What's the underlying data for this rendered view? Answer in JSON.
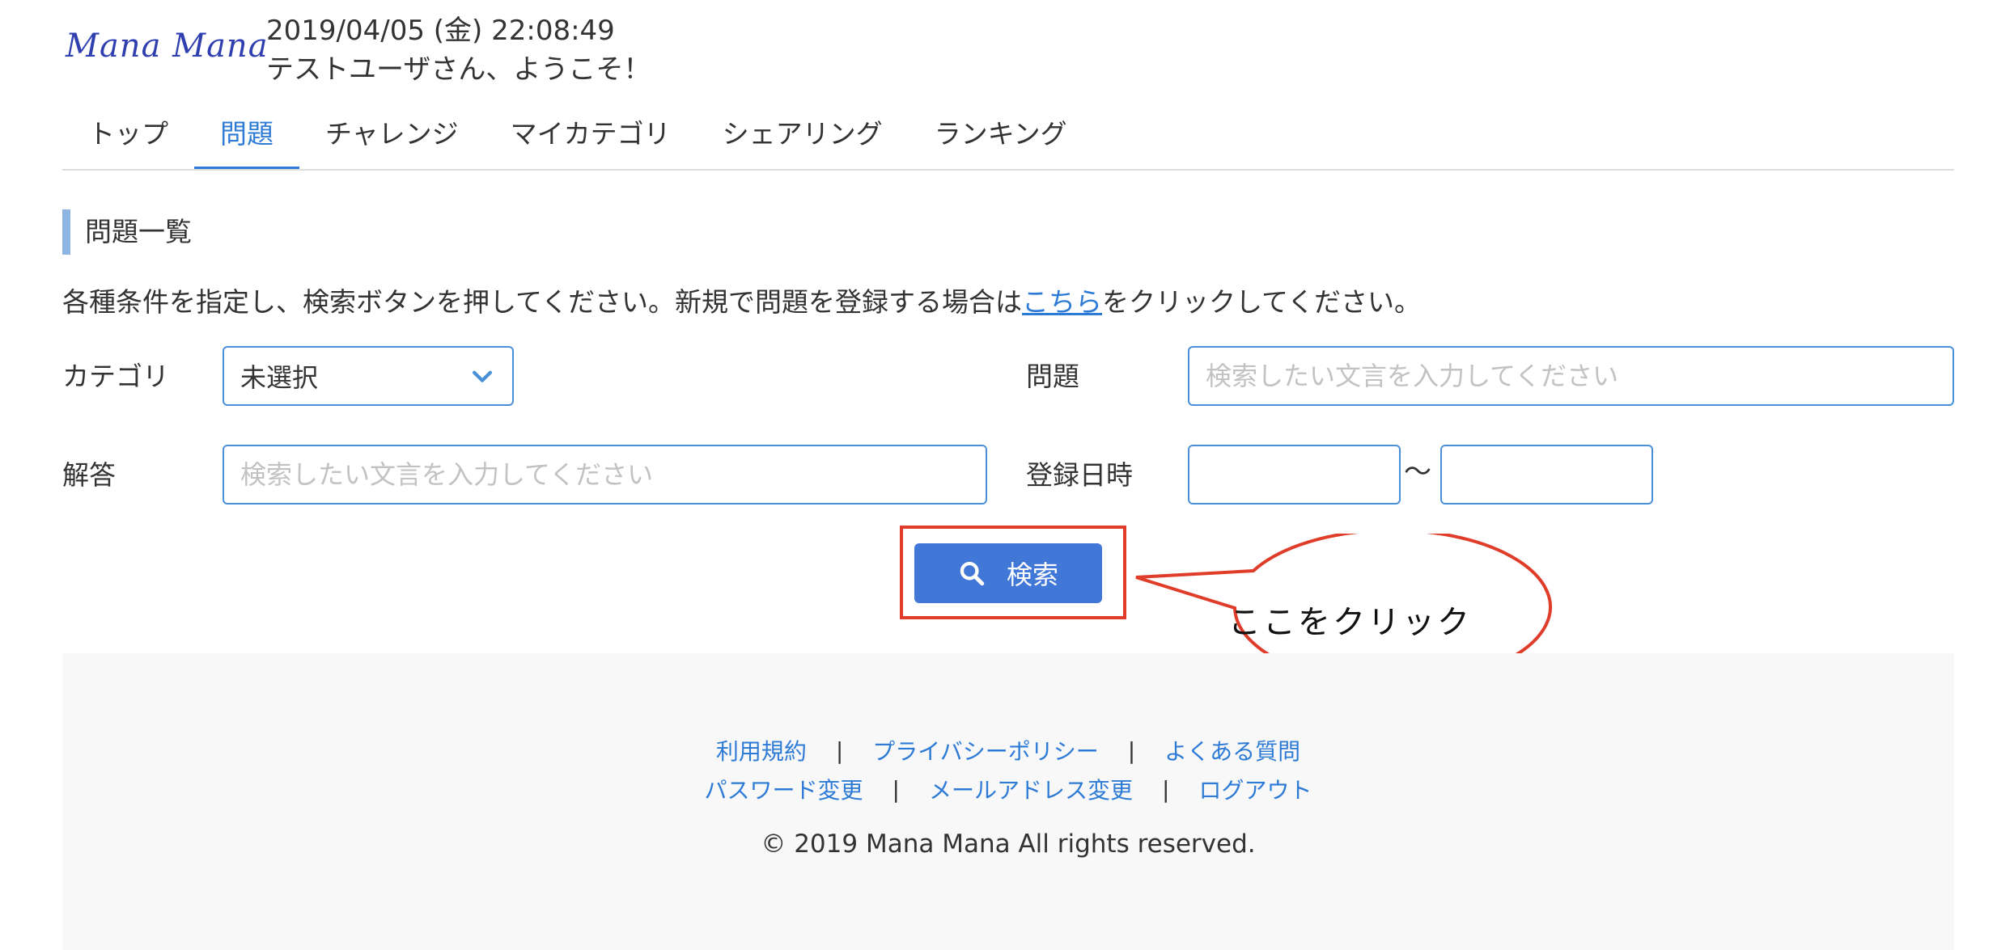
{
  "header": {
    "logo": "Mana Mana",
    "datetime": "2019/04/05 (金) 22:08:49",
    "welcome": "テストユーザさん、ようこそ！"
  },
  "nav": {
    "tabs": [
      {
        "label": "トップ",
        "active": false
      },
      {
        "label": "問題",
        "active": true
      },
      {
        "label": "チャレンジ",
        "active": false
      },
      {
        "label": "マイカテゴリ",
        "active": false
      },
      {
        "label": "シェアリング",
        "active": false
      },
      {
        "label": "ランキング",
        "active": false
      }
    ]
  },
  "section": {
    "title": "問題一覧",
    "instructions_before": "各種条件を指定し、検索ボタンを押してください。新規で問題を登録する場合は",
    "instructions_link": "こちら",
    "instructions_after": "をクリックしてください。"
  },
  "form": {
    "category_label": "カテゴリ",
    "category_value": "未選択",
    "question_label": "問題",
    "question_placeholder": "検索したい文言を入力してください",
    "answer_label": "解答",
    "answer_placeholder": "検索したい文言を入力してください",
    "date_label": "登録日時",
    "date_separator": "〜",
    "date_from": "",
    "date_to": ""
  },
  "search": {
    "label": "検索"
  },
  "callout": {
    "text": "ここをクリック"
  },
  "footer": {
    "links_row1": [
      "利用規約",
      "プライバシーポリシー",
      "よくある質問"
    ],
    "links_row2": [
      "パスワード変更",
      "メールアドレス変更",
      "ログアウト"
    ],
    "separator": "|",
    "copyright": "© 2019 Mana Mana All rights reserved."
  },
  "colors": {
    "accent": "#2e7bd6",
    "button": "#4178d8",
    "highlight": "#e03c2a",
    "section_bar": "#8db4e2"
  }
}
